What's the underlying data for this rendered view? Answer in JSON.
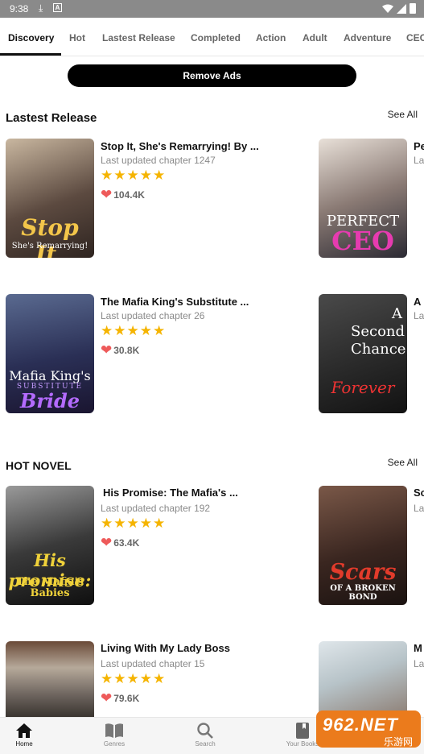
{
  "status_bar": {
    "time": "9:38",
    "download_glyph": "⤓",
    "a_glyph": "A"
  },
  "tabs": [
    "Discovery",
    "Hot",
    "Lastest Release",
    "Completed",
    "Action",
    "Adult",
    "Adventure",
    "CEO"
  ],
  "remove_ads": "Remove Ads",
  "sections": {
    "latest": {
      "title": "Lastest Release",
      "see_all": "See All"
    },
    "hot": {
      "title": "HOT NOVEL",
      "see_all": "See All"
    }
  },
  "books": [
    {
      "title": "Stop It, She's Remarrying! By ...",
      "chapter": "Last updated chapter 1247",
      "stars": "★★★★★",
      "likes": "104.4K",
      "cover_main": "Stop It,",
      "cover_sub": "She's Remarrying!"
    },
    {
      "title": "The Mafia King's Substitute ...",
      "chapter": "Last updated chapter 26",
      "stars": "★★★★★",
      "likes": "30.8K",
      "cover_main": "Mafia King's",
      "cover_sub": "SUBSTITUTE",
      "cover_third": "Bride"
    },
    {
      "title": "His Promise: The Mafia's ...",
      "chapter": "Last updated chapter 192",
      "stars": "★★★★★",
      "likes": "63.4K",
      "cover_main": "His promise:",
      "cover_sub": "The Mafia's",
      "cover_third": "Babies"
    },
    {
      "title": "Living With My Lady Boss",
      "chapter": "Last updated chapter 15",
      "stars": "★★★★★",
      "likes": "79.6K"
    }
  ],
  "side_books": [
    {
      "title_initial": "Pe",
      "sub_initial": "La",
      "cover_main": "PERFECT",
      "cover_sub": "CEO"
    },
    {
      "title_initial": "A",
      "sub_initial": "La",
      "cover_main": "A Second Chance",
      "cover_sub": "Forever"
    },
    {
      "title_initial": "Sc",
      "sub_initial": "La",
      "cover_main": "Scars",
      "cover_sub": "OF A BROKEN BOND"
    },
    {
      "title_initial": "M",
      "sub_initial": "La"
    }
  ],
  "nav": [
    {
      "label": "Home",
      "icon": "home-icon"
    },
    {
      "label": "Genres",
      "icon": "book-open-icon"
    },
    {
      "label": "Search",
      "icon": "search-icon"
    },
    {
      "label": "Your Books",
      "icon": "bookmark-icon"
    }
  ],
  "watermark": {
    "main": "962.NET",
    "sub": "乐游网"
  },
  "colors": {
    "star": "#f5b400",
    "heart": "#ee5a5a",
    "accent": "#000000"
  }
}
